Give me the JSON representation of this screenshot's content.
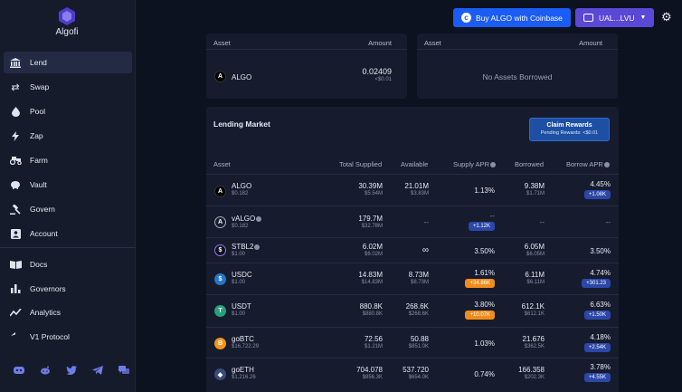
{
  "app": {
    "name": "Algofi"
  },
  "nav": [
    {
      "label": "Lend",
      "icon": "bank-icon",
      "active": true
    },
    {
      "label": "Swap",
      "icon": "swap-arrows-icon"
    },
    {
      "label": "Pool",
      "icon": "droplet-icon"
    },
    {
      "label": "Zap",
      "icon": "lightning-icon"
    },
    {
      "label": "Farm",
      "icon": "tractor-icon"
    },
    {
      "label": "Vault",
      "icon": "piggy-bank-icon"
    },
    {
      "label": "Govern",
      "icon": "gavel-icon"
    },
    {
      "label": "Account",
      "icon": "account-card-icon"
    },
    {
      "label": "Docs",
      "icon": "book-icon"
    },
    {
      "label": "Governors",
      "icon": "bar-chart-icon"
    },
    {
      "label": "Analytics",
      "icon": "line-chart-icon"
    },
    {
      "label": "V1 Protocol",
      "icon": "reply-arrow-icon"
    }
  ],
  "socials": [
    "discord-icon",
    "reddit-icon",
    "twitter-icon",
    "telegram-icon",
    "forum-icon"
  ],
  "header": {
    "coinbase_label": "Buy ALGO with Coinbase",
    "wallet_label": "UAL...LVU"
  },
  "supplied_card": {
    "asset_header": "Asset",
    "amount_header": "Amount",
    "row": {
      "asset": "ALGO",
      "amount": "0.02409",
      "usd": "<$0.01"
    }
  },
  "borrowed_card": {
    "asset_header": "Asset",
    "amount_header": "Amount",
    "empty_text": "No Assets Borrowed"
  },
  "market": {
    "title": "Lending Market",
    "claim_label": "Claim Rewards",
    "pending_label": "Pending Rewards: <$0.01",
    "headers": {
      "asset": "Asset",
      "total_supplied": "Total Supplied",
      "available": "Available",
      "supply_apr": "Supply APR",
      "borrowed": "Borrowed",
      "borrow_apr": "Borrow APR"
    },
    "rows": [
      {
        "asset": "ALGO",
        "price": "$0.182",
        "icon": "algo-icon",
        "total_supplied": "30.39M",
        "total_supplied_usd": "$5.54M",
        "available": "21.01M",
        "available_usd": "$3.83M",
        "supply_apr": "1.13%",
        "supply_badge": "",
        "supply_badge_color": "",
        "borrowed": "9.38M",
        "borrowed_usd": "$1.71M",
        "borrow_apr": "4.45%",
        "borrow_badge": "+1.08K"
      },
      {
        "asset": "vALGO",
        "price": "$0.182",
        "icon": "valgo-icon",
        "total_supplied": "179.7M",
        "total_supplied_usd": "$32.78M",
        "available": "--",
        "available_usd": "",
        "supply_apr": "--",
        "supply_badge": "+1.12K",
        "supply_badge_color": "blue",
        "borrowed": "--",
        "borrowed_usd": "",
        "borrow_apr": "--",
        "borrow_badge": ""
      },
      {
        "asset": "STBL2",
        "price": "$1.00",
        "icon": "stbl2-icon",
        "total_supplied": "6.02M",
        "total_supplied_usd": "$6.02M",
        "available": "∞",
        "available_usd": "",
        "supply_apr": "3.50%",
        "supply_badge": "",
        "supply_badge_color": "",
        "borrowed": "6.05M",
        "borrowed_usd": "$6.05M",
        "borrow_apr": "3.50%",
        "borrow_badge": ""
      },
      {
        "asset": "USDC",
        "price": "$1.00",
        "icon": "usdc-icon",
        "total_supplied": "14.83M",
        "total_supplied_usd": "$14.83M",
        "available": "8.73M",
        "available_usd": "$8.73M",
        "supply_apr": "1.61%",
        "supply_badge": "+34.86K",
        "supply_badge_color": "orange",
        "borrowed": "6.11M",
        "borrowed_usd": "$6.11M",
        "borrow_apr": "4.74%",
        "borrow_badge": "+301.23"
      },
      {
        "asset": "USDT",
        "price": "$1.00",
        "icon": "usdt-icon",
        "total_supplied": "880.8K",
        "total_supplied_usd": "$880.8K",
        "available": "268.6K",
        "available_usd": "$268.6K",
        "supply_apr": "3.80%",
        "supply_badge": "+10.07K",
        "supply_badge_color": "orange",
        "borrowed": "612.1K",
        "borrowed_usd": "$612.1K",
        "borrow_apr": "6.63%",
        "borrow_badge": "+1.50K"
      },
      {
        "asset": "goBTC",
        "price": "$16,722.29",
        "icon": "gobtc-icon",
        "total_supplied": "72.56",
        "total_supplied_usd": "$1.21M",
        "available": "50.88",
        "available_usd": "$851.0K",
        "supply_apr": "1.03%",
        "supply_badge": "",
        "supply_badge_color": "",
        "borrowed": "21.676",
        "borrowed_usd": "$362.5K",
        "borrow_apr": "4.18%",
        "borrow_badge": "+2.54K"
      },
      {
        "asset": "goETH",
        "price": "$1,216.26",
        "icon": "goeth-icon",
        "total_supplied": "704.078",
        "total_supplied_usd": "$856.3K",
        "available": "537.720",
        "available_usd": "$654.0K",
        "supply_apr": "0.74%",
        "supply_badge": "",
        "supply_badge_color": "",
        "borrowed": "166.358",
        "borrowed_usd": "$202.3K",
        "borrow_apr": "3.78%",
        "borrow_badge": "+4.55K"
      }
    ]
  },
  "colors": {
    "accent": "#5a48d6",
    "coinbase": "#1b5cf4",
    "badge_blue": "#2b47a8",
    "badge_orange": "#f08c1c"
  }
}
